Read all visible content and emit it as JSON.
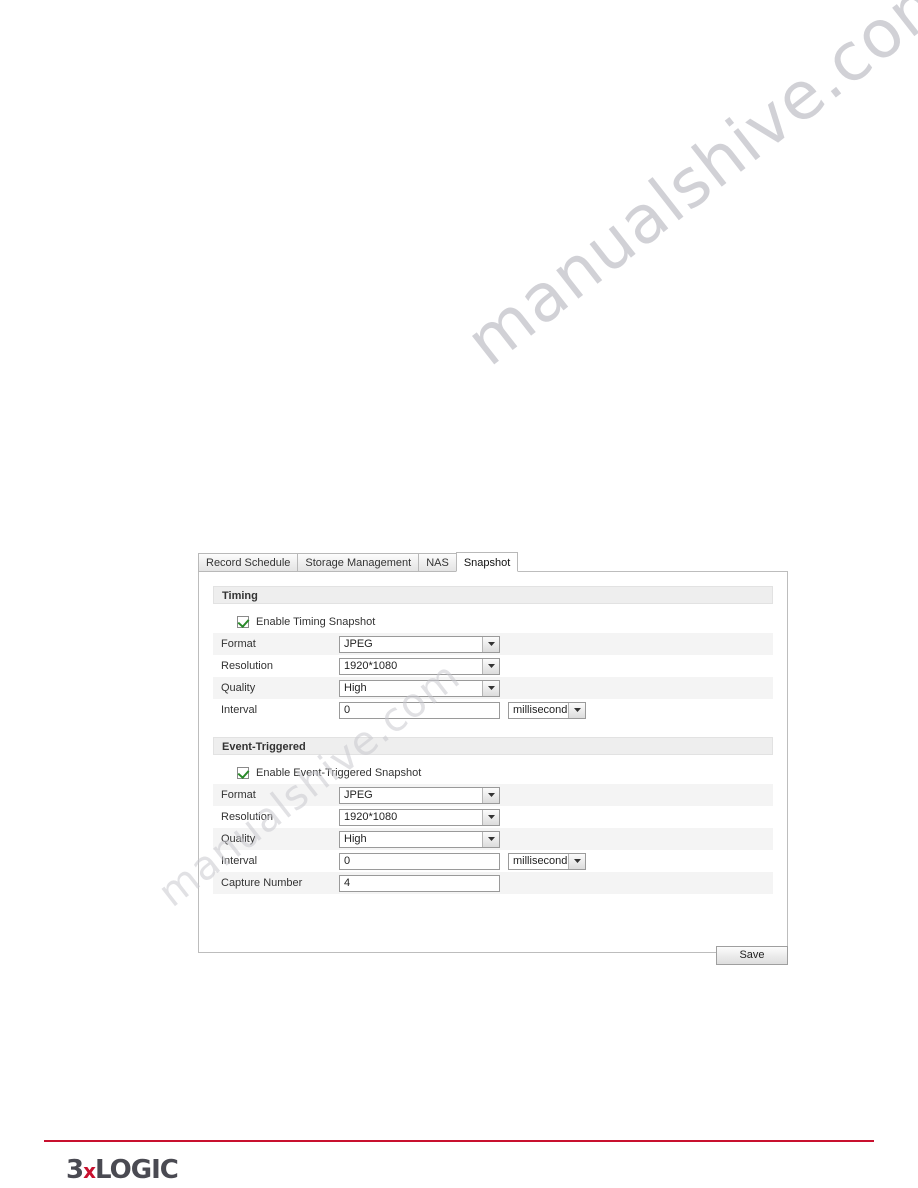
{
  "watermark": {
    "main": "manualshive.com",
    "secondary": "manualshive.com"
  },
  "tabs": [
    {
      "label": "Record Schedule",
      "active": false
    },
    {
      "label": "Storage Management",
      "active": false
    },
    {
      "label": "NAS",
      "active": false
    },
    {
      "label": "Snapshot",
      "active": true
    }
  ],
  "timing": {
    "section_title": "Timing",
    "enable_label": "Enable Timing Snapshot",
    "enabled": true,
    "rows": {
      "format_label": "Format",
      "format_value": "JPEG",
      "resolution_label": "Resolution",
      "resolution_value": "1920*1080",
      "quality_label": "Quality",
      "quality_value": "High",
      "interval_label": "Interval",
      "interval_value": "0",
      "interval_unit": "millisecond"
    }
  },
  "event_triggered": {
    "section_title": "Event-Triggered",
    "enable_label": "Enable Event-Triggered Snapshot",
    "enabled": true,
    "rows": {
      "format_label": "Format",
      "format_value": "JPEG",
      "resolution_label": "Resolution",
      "resolution_value": "1920*1080",
      "quality_label": "Quality",
      "quality_value": "High",
      "interval_label": "Interval",
      "interval_value": "0",
      "interval_unit": "millisecond",
      "capture_number_label": "Capture Number",
      "capture_number_value": "4"
    }
  },
  "actions": {
    "save_label": "Save"
  },
  "footer": {
    "logo_left": "3",
    "logo_x": "x",
    "logo_right": "LOGIC",
    "rule_color": "#c8102e"
  }
}
